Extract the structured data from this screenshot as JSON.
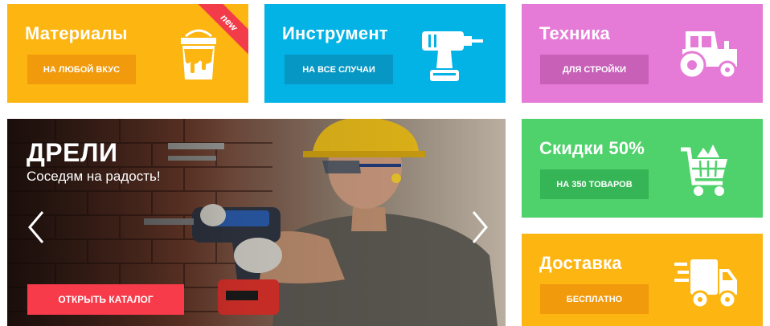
{
  "colors": {
    "materials": "#fdb512",
    "materials_btn": "#f19a0b",
    "tools": "#03b3e5",
    "tools_btn": "#0797c4",
    "tech": "#e57bd6",
    "tech_btn": "#c860b8",
    "discount": "#4fd16b",
    "discount_btn": "#36b556",
    "delivery": "#fdb512",
    "delivery_btn": "#f19a0b",
    "hero_btn": "#f73b4a",
    "ribbon": "#f23c4a"
  },
  "tiles": {
    "materials": {
      "title": "Материалы",
      "button": "НА ЛЮБОЙ ВКУС",
      "badge": "new",
      "icon": "paint-bucket-icon"
    },
    "tools": {
      "title": "Инструмент",
      "button": "НА ВСЕ СЛУЧАИ",
      "icon": "drill-icon"
    },
    "tech": {
      "title": "Техника",
      "button": "ДЛЯ СТРОЙКИ",
      "icon": "tractor-icon"
    },
    "discount": {
      "title": "Скидки 50%",
      "button": "НА 350 ТОВАРОВ",
      "icon": "shopping-cart-icon"
    },
    "delivery": {
      "title": "Доставка",
      "button": "БЕСПЛАТНО",
      "icon": "delivery-truck-icon"
    }
  },
  "hero": {
    "title": "ДРЕЛИ",
    "subtitle": "Соседям на радость!",
    "button": "ОТКРЫТЬ КАТАЛОГ",
    "prev_icon": "chevron-left-icon",
    "next_icon": "chevron-right-icon"
  }
}
